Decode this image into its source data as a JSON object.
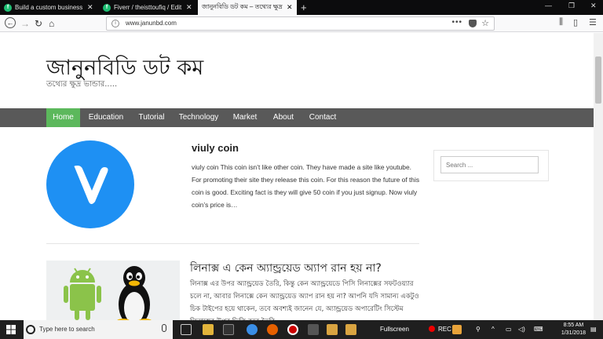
{
  "browser": {
    "tabs": [
      {
        "label": "Build a custom business word"
      },
      {
        "label": "Fiverr / theisttoufiq / Edit Gig"
      },
      {
        "label": "জানুনবিডি ডট কম – তথ্যের ক্ষুদ্র ভা"
      }
    ],
    "url": "www.janunbd.com"
  },
  "site": {
    "title": "জানুনবিডি ডট কম",
    "tagline": "তথ্যের ক্ষুদ্র ভান্ডার.....",
    "menu": [
      "Home",
      "Education",
      "Tutorial",
      "Technology",
      "Market",
      "About",
      "Contact"
    ]
  },
  "posts": [
    {
      "title": "viuly coin",
      "excerpt": "viuly coin This coin isn’t like other coin. They have made a site like youtube. For promoting their site they release this coin. For this reason the future of this coin is good. Exciting fact is they will give 50 coin if you just signup. Now viuly coin’s price is…"
    },
    {
      "title": "লিনাক্স এ কেন অ্যান্ড্রয়েড অ্যাপ রান হয় না?",
      "excerpt": "লিনাক্স এর উপর অ্যান্ড্রয়েড তৈরি, কিন্তু কেন অ্যান্ড্রয়েডে পিসি লিনাক্সের সফটওয়্যার চলে না, আবার লিনাক্সে কেন অ্যান্ড্রয়েড অ্যাপ রান হয় না? আপনি যদি সামান্য একটুও চিক টাইপের হয়ে থাকেন, তবে অবশ্যই জানেন যে, অ্যান্ড্রয়েড অপারেটিং সিস্টেম লিনাক্সের উপর ভিত্তি করে তৈরি"
    }
  ],
  "sidebar": {
    "search_placeholder": "Search ..."
  },
  "taskbar": {
    "search_placeholder": "Type here to search",
    "fullscreen_label": "Fullscreen",
    "rec_label": "REC",
    "time": "8:55 AM",
    "date": "1/31/2018"
  },
  "colors": {
    "menu_bg": "#595959",
    "menu_active": "#5cb85c",
    "coin_blue": "#1e90f3"
  }
}
